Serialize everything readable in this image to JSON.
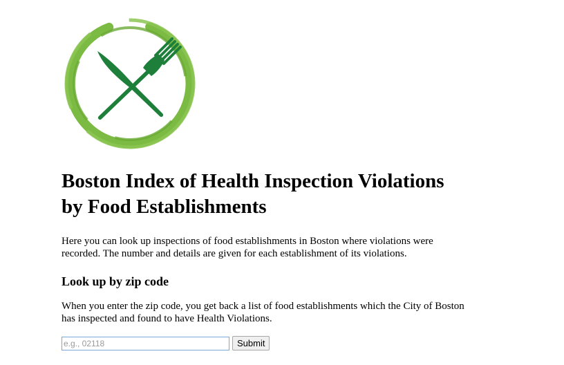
{
  "logo": {
    "icon": "fork-and-knife-icon",
    "ring_color": "#7cbb43",
    "utensil_color": "#1d7f3a"
  },
  "title": "Boston Index of Health Inspection Violations by Food Establishments",
  "intro": "Here you can look up inspections of food establishments in Boston where violations were recorded. The number and details are given for each establishment of its violations.",
  "zip_section": {
    "heading": "Look up by zip code",
    "description": "When you enter the zip code, you get back a list of food establishments which the City of Boston has inspected and found to have Health Violations.",
    "input_value": "",
    "input_placeholder": "e.g., 02118",
    "submit_label": "Submit"
  }
}
